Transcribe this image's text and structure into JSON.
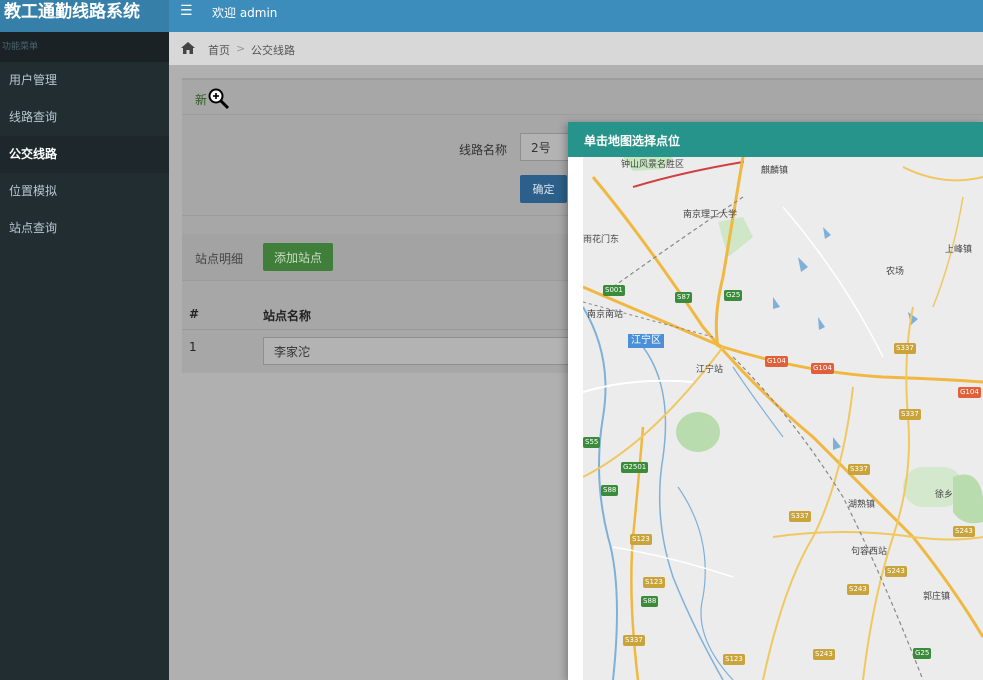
{
  "app": {
    "title": "教工通勤线路系统",
    "welcome": "欢迎 admin",
    "menu_icon": "hamburger-icon"
  },
  "sidebar": {
    "header": "功能菜单",
    "items": [
      {
        "label": "用户管理",
        "active": false
      },
      {
        "label": "线路查询",
        "active": false
      },
      {
        "label": "公交线路",
        "active": true
      },
      {
        "label": "位置模拟",
        "active": false
      },
      {
        "label": "站点查询",
        "active": false
      }
    ]
  },
  "breadcrumb": {
    "home_icon": "home-icon",
    "home": "首页",
    "separator": ">",
    "current": "公交线路"
  },
  "panel": {
    "new_label": "新",
    "route_name_label": "线路名称",
    "route_name_value": "2号",
    "confirm_label": "确定",
    "station_detail_label": "站点明细",
    "add_station_label": "添加站点",
    "table": {
      "columns": [
        "#",
        "站点名称"
      ],
      "rows": [
        {
          "index": "1",
          "name": "李家沱"
        }
      ]
    }
  },
  "modal": {
    "title": "单击地图选择点位",
    "map_labels": [
      "钟山风景名胜区",
      "麒麟镇",
      "南京理工大学",
      "雨花门东",
      "上峰镇",
      "农场",
      "南京南站",
      "江宁区",
      "江宁站",
      "湖熟镇",
      "句容西站",
      "徐乡",
      "郭庄镇"
    ],
    "road_shields": [
      "S001",
      "S87",
      "G25",
      "G104",
      "G104",
      "G104",
      "S337",
      "S337",
      "S337",
      "S337",
      "G2501",
      "S88",
      "S55",
      "S123",
      "S123",
      "S88",
      "S337",
      "S243",
      "S243",
      "S243",
      "S243",
      "G25",
      "S123"
    ]
  },
  "colors": {
    "topbar": "#3c8dbc",
    "sidebar": "#222d32",
    "modal_header": "#26948a",
    "confirm": "#2c5f8a",
    "add": "#3f7f3a"
  }
}
